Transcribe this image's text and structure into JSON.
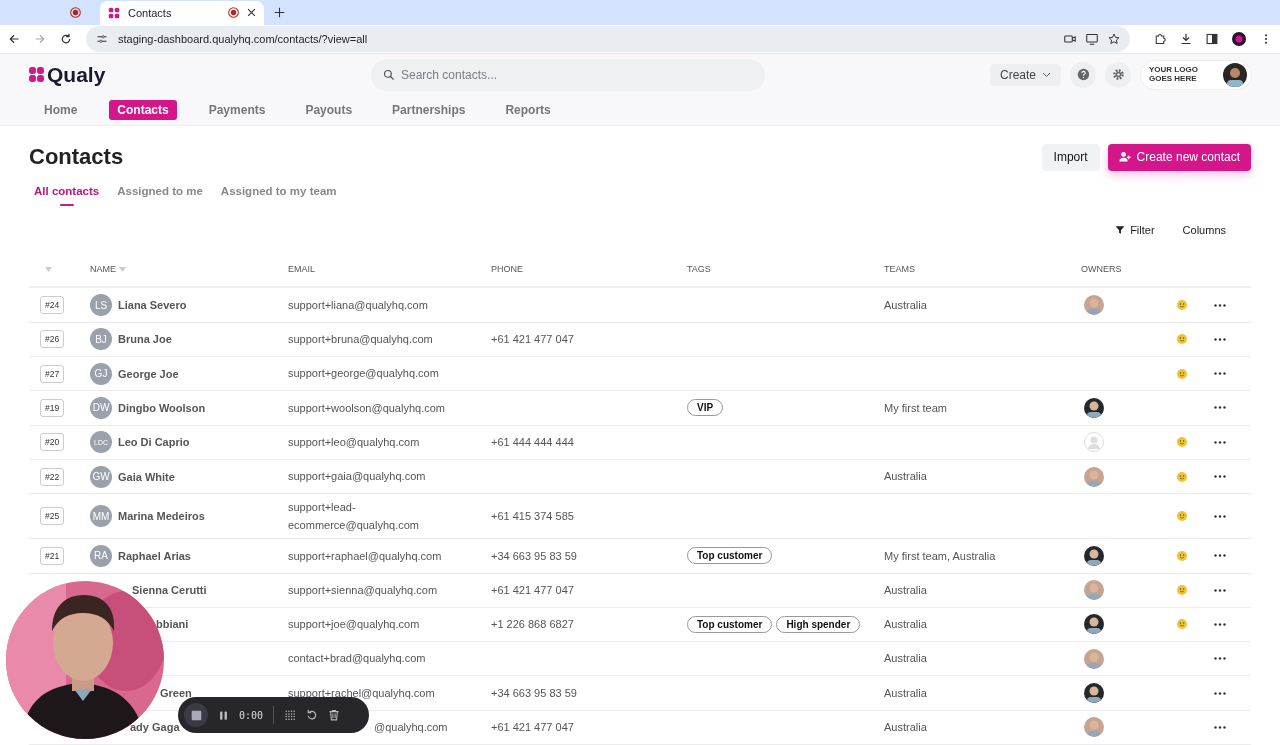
{
  "browser": {
    "tabs": [
      {
        "selected": false
      },
      {
        "title": "Contacts",
        "selected": true
      }
    ],
    "url": "staging-dashboard.qualyhq.com/contacts/?view=all"
  },
  "header": {
    "brand": "Qualy",
    "search": {
      "placeholder": "Search contacts..."
    },
    "create": "Create",
    "logo_text": "YOUR LOGO GOES HERE"
  },
  "nav": [
    {
      "label": "Home",
      "selected": false
    },
    {
      "label": "Contacts",
      "selected": true
    },
    {
      "label": "Payments",
      "selected": false
    },
    {
      "label": "Payouts",
      "selected": false
    },
    {
      "label": "Partnerships",
      "selected": false
    },
    {
      "label": "Reports",
      "selected": false
    }
  ],
  "page": {
    "title": "Contacts",
    "import": "Import",
    "create_contact": "Create new contact"
  },
  "tabs": [
    {
      "label": "All contacts",
      "selected": true
    },
    {
      "label": "Assigned to me",
      "selected": false
    },
    {
      "label": "Assigned to my team",
      "selected": false
    }
  ],
  "toolbar": {
    "filter": "Filter",
    "columns": "Columns"
  },
  "table": {
    "columns": [
      "NAME",
      "EMAIL",
      "PHONE",
      "TAGS",
      "TEAMS",
      "OWNERS"
    ],
    "rows": [
      {
        "id": "#24",
        "initials": "LS",
        "name": "Liana Severo",
        "email": "support+liana@qualyhq.com",
        "phone": "",
        "tags": [],
        "teams": "Australia",
        "owner": {
          "kind": "picture",
          "color": "#c9a392"
        },
        "reaction": true
      },
      {
        "id": "#26",
        "initials": "BJ",
        "name": "Bruna Joe",
        "email": "support+bruna@qualyhq.com",
        "phone": "+61 421 477 047",
        "tags": [],
        "teams": "",
        "reaction": true
      },
      {
        "id": "#27",
        "initials": "GJ",
        "name": "George Joe",
        "email": "support+george@qualyhq.com",
        "phone": "",
        "tags": [],
        "teams": "",
        "reaction": true
      },
      {
        "id": "#19",
        "initials": "DW",
        "name": "Dingbo Woolson",
        "email": "support+woolson@qualyhq.com",
        "phone": "",
        "tags": [
          "VIP"
        ],
        "teams": "My first team",
        "owner": {
          "kind": "picture",
          "color": "#23282d"
        },
        "reaction": false
      },
      {
        "id": "#20",
        "initials": "LDC",
        "name": "Leo Di Caprio",
        "email": "support+leo@qualyhq.com",
        "phone": "+61 444 444 444",
        "tags": [],
        "teams": "",
        "owner": {
          "kind": "placeholder"
        },
        "reaction": true
      },
      {
        "id": "#22",
        "initials": "GW",
        "name": "Gaia White",
        "email": "support+gaia@qualyhq.com",
        "phone": "",
        "tags": [],
        "teams": "Australia",
        "owner": {
          "kind": "picture",
          "color": "#c9a392"
        },
        "reaction": true
      },
      {
        "id": "#25",
        "initials": "MM",
        "name": "Marina Medeiros",
        "email": "support+lead-ecommerce@qualyhq.com",
        "phone": "+61 415 374 585",
        "tags": [],
        "teams": "",
        "reaction": true
      },
      {
        "id": "#21",
        "initials": "RA",
        "name": "Raphael Arias",
        "email": "support+raphael@qualyhq.com",
        "phone": "+34 663 95 83 59",
        "tags": [
          "Top customer"
        ],
        "teams": "My first team, Australia",
        "owner": {
          "kind": "picture",
          "color": "#23282d"
        },
        "reaction": true
      },
      {
        "name": "Sienna Cerutti",
        "email": "support+sienna@qualyhq.com",
        "phone": "+61 421 477 047",
        "tags": [],
        "teams": "Australia",
        "owner": {
          "kind": "picture",
          "color": "#c9a392"
        },
        "reaction": true
      },
      {
        "name": "bbiani",
        "email": "support+joe@qualyhq.com",
        "phone": "+1 226 868 6827",
        "tags": [
          "Top customer",
          "High spender"
        ],
        "teams": "Australia",
        "owner": {
          "kind": "picture",
          "color": "#23282d"
        },
        "reaction": true
      },
      {
        "email": "contact+brad@qualyhq.com",
        "phone": "",
        "tags": [],
        "teams": "Australia",
        "owner": {
          "kind": "picture",
          "color": "#c9a392"
        },
        "reaction": false
      },
      {
        "name": "Green",
        "email": "support+rachel@qualyhq.com",
        "phone": "+34 663 95 83 59",
        "tags": [],
        "teams": "Australia",
        "owner": {
          "kind": "picture",
          "color": "#23282d"
        },
        "reaction": false
      },
      {
        "name": "ady Gaga",
        "email": "@qualyhq.com",
        "phone": "+61 421 477 047",
        "tags": [],
        "teams": "Australia",
        "owner": {
          "kind": "picture",
          "color": "#c9a392"
        },
        "reaction": false
      }
    ]
  },
  "recorder": {
    "time": "0:00"
  }
}
